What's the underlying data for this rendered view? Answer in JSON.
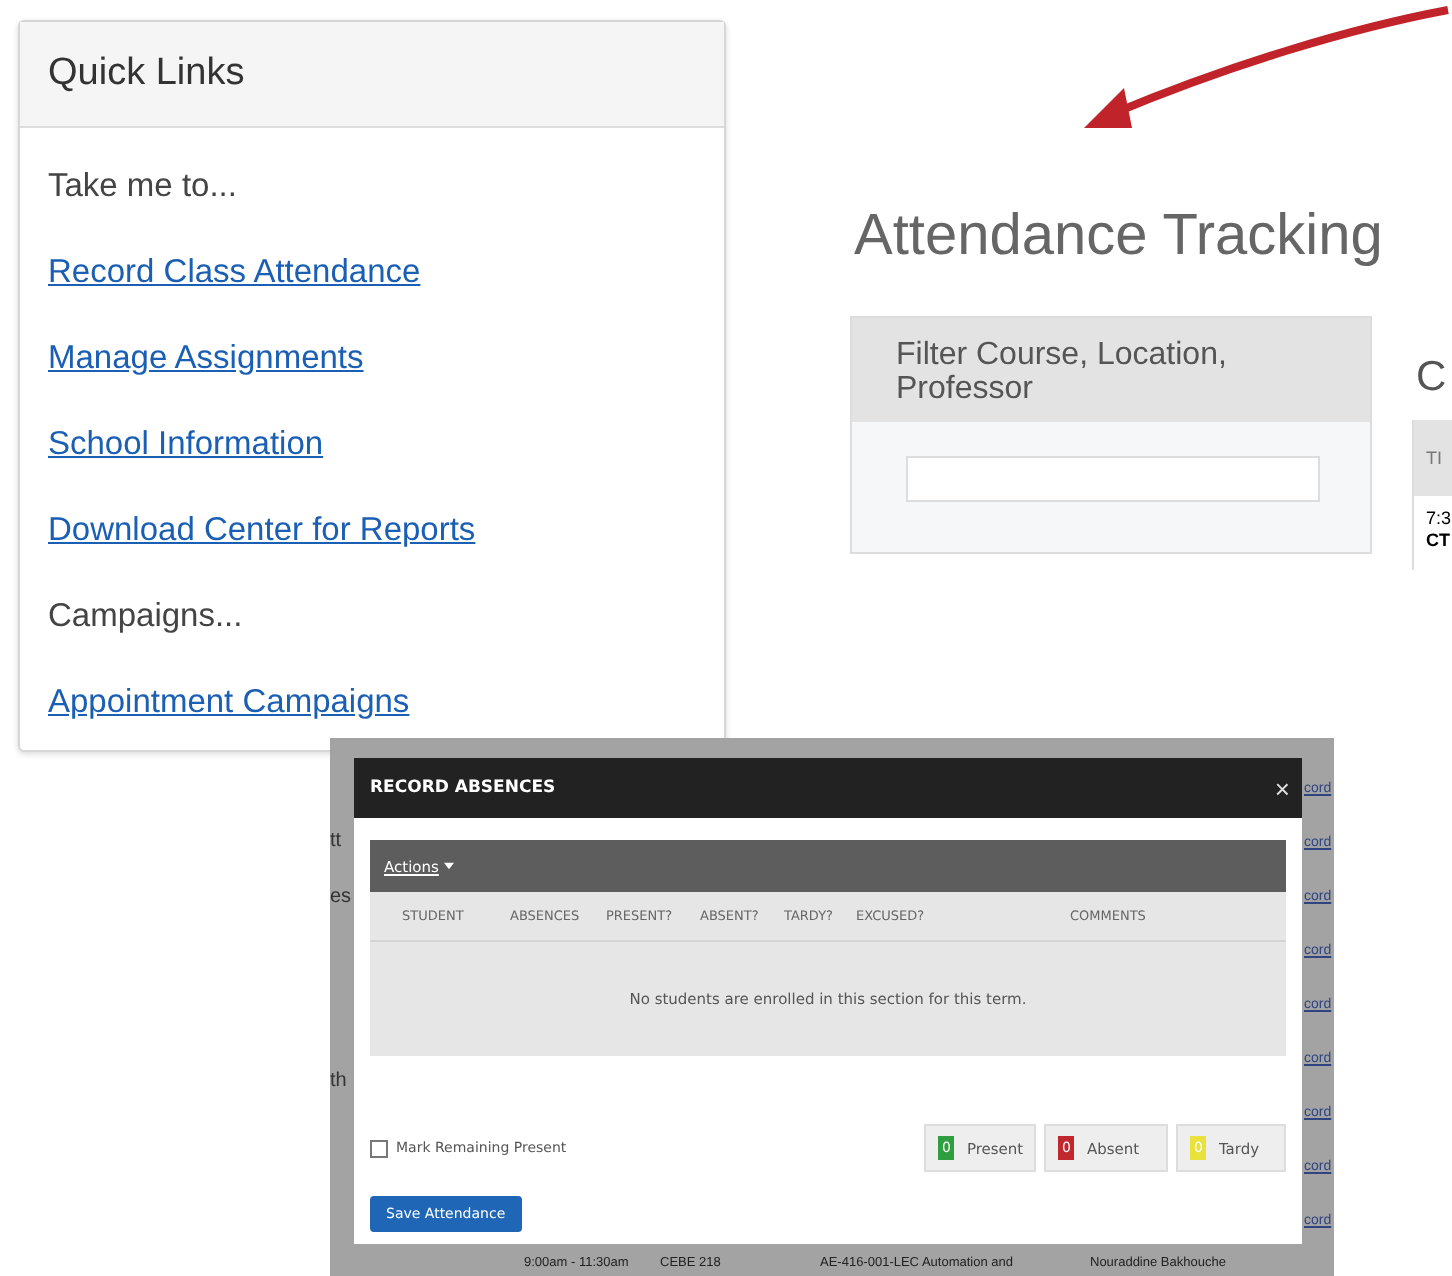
{
  "quick_links": {
    "title": "Quick Links",
    "items": [
      {
        "kind": "label",
        "text": "Take me to..."
      },
      {
        "kind": "link",
        "text": "Record Class Attendance"
      },
      {
        "kind": "link",
        "text": "Manage Assignments"
      },
      {
        "kind": "link",
        "text": "School Information"
      },
      {
        "kind": "link",
        "text": "Download Center for Reports"
      },
      {
        "kind": "label",
        "text": "Campaigns..."
      },
      {
        "kind": "link",
        "text": "Appointment Campaigns"
      }
    ]
  },
  "attendance": {
    "title": "Attendance Tracking",
    "filter": {
      "title": "Filter Course, Location, Professor"
    },
    "section_title": "C",
    "table_header": "TI",
    "row_time": "7:3",
    "row_code": "CT"
  },
  "modal_screenshot": {
    "background": {
      "left_texts": [
        "tt",
        "es",
        "th"
      ],
      "right_links": [
        "cord",
        "cord",
        "cord",
        "cord",
        "cord",
        "cord",
        "cord",
        "cord",
        "cord"
      ],
      "bottom_row": [
        "9:00am - 11:30am",
        "CEBE 218",
        "AE-416-001-LEC Automation and",
        "Nouraddine Bakhouche"
      ]
    },
    "dialog": {
      "title": "RECORD ABSENCES",
      "close": "×",
      "actions": "Actions",
      "columns": [
        "STUDENT",
        "ABSENCES",
        "PRESENT?",
        "ABSENT?",
        "TARDY?",
        "EXCUSED?",
        "COMMENTS"
      ],
      "empty_message": "No students are enrolled in this section for this term.",
      "mark_remaining": {
        "label": "Mark Remaining Present",
        "checked": false
      },
      "counters": [
        {
          "count": "0",
          "label": "Present",
          "color": "#2e9e3e"
        },
        {
          "count": "0",
          "label": "Absent",
          "color": "#c0282d"
        },
        {
          "count": "0",
          "label": "Tardy",
          "color": "#e8e23a"
        }
      ],
      "save": "Save Attendance"
    }
  }
}
